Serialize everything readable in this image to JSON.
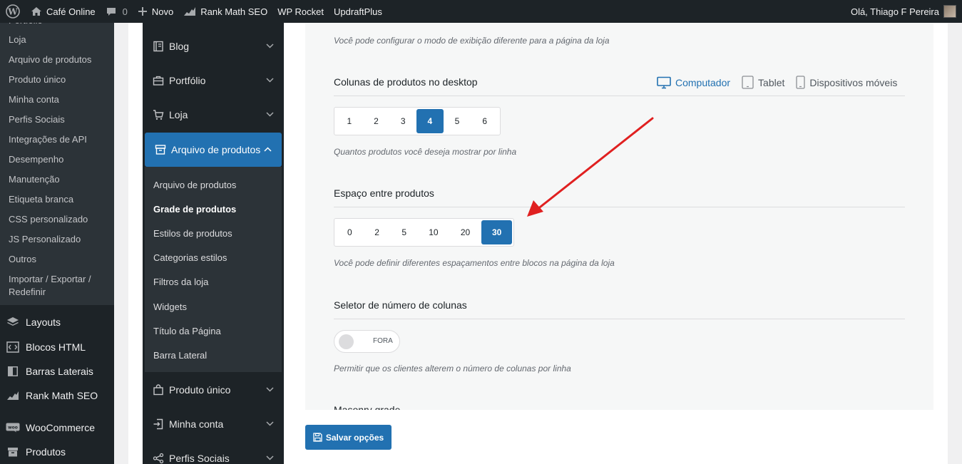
{
  "admin_bar": {
    "site_name": "Café Online",
    "comments": "0",
    "new_label": "Novo",
    "rank_math": "Rank Math SEO",
    "wp_rocket": "WP Rocket",
    "updraft": "UpdraftPlus",
    "greeting": "Olá, Thiago F Pereira"
  },
  "wp_menu": {
    "submenu": [
      "Portfólio",
      "Loja",
      "Arquivo de produtos",
      "Produto único",
      "Minha conta",
      "Perfis Sociais",
      "Integrações de API",
      "Desempenho",
      "Manutenção",
      "Etiqueta branca",
      "CSS personalizado",
      "JS Personalizado",
      "Outros",
      "Importar / Exportar /",
      "Redefinir"
    ],
    "items": [
      "Layouts",
      "Blocos HTML",
      "Barras Laterais",
      "Rank Math SEO",
      "WooCommerce",
      "Produtos"
    ]
  },
  "options_nav": {
    "sections": {
      "blog": "Blog",
      "portfolio": "Portfólio",
      "loja": "Loja",
      "arquivo": "Arquivo de produtos",
      "produto_unico": "Produto único",
      "minha_conta": "Minha conta",
      "perfis": "Perfis Sociais"
    },
    "subitems": [
      "Arquivo de produtos",
      "Grade de produtos",
      "Estilos de produtos",
      "Categorias estilos",
      "Filtros da loja",
      "Widgets",
      "Título da Página",
      "Barra Lateral"
    ]
  },
  "settings": {
    "top_help": "Você pode configurar o modo de exibição diferente para a página da loja",
    "columns": {
      "label": "Colunas de produtos no desktop",
      "options": [
        "1",
        "2",
        "3",
        "4",
        "5",
        "6"
      ],
      "selected": "4",
      "help": "Quantos produtos você deseja mostrar por linha"
    },
    "devices": [
      "Computador",
      "Tablet",
      "Dispositivos móveis"
    ],
    "spacing": {
      "label": "Espaço entre produtos",
      "options": [
        "0",
        "2",
        "5",
        "10",
        "20",
        "30"
      ],
      "selected": "30",
      "help": "Você pode definir diferentes espaçamentos entre blocos na página da loja"
    },
    "column_selector": {
      "label": "Seletor de número de colunas",
      "state": "FORA",
      "help": "Permitir que os clientes alterem o número de colunas por linha"
    },
    "next_label": "Masonry grade"
  },
  "save_label": "Salvar opções",
  "colors": {
    "accent": "#2271b1",
    "dark": "#1d2327",
    "arrow": "#e02020"
  }
}
